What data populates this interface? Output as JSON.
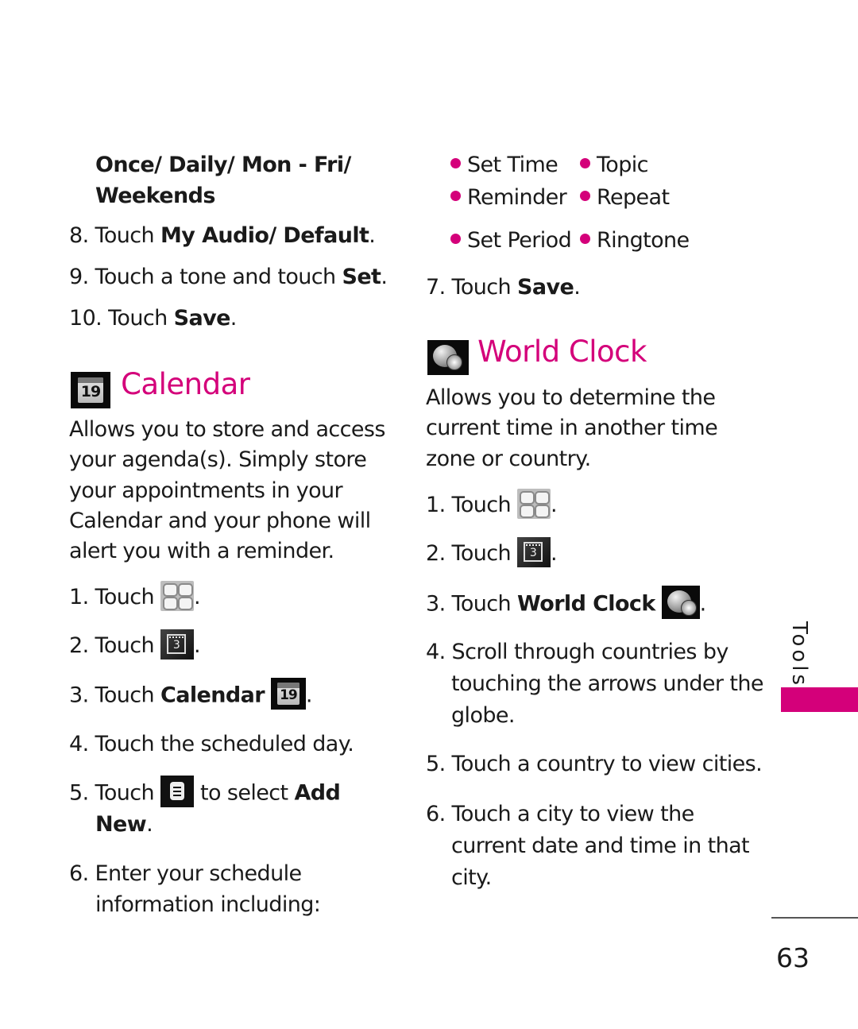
{
  "left_column": {
    "continued_options": {
      "text": "Once/ Daily/ Mon - Fri/",
      "text2": "Weekends"
    },
    "steps_top": [
      {
        "num": "8.",
        "pre": "Touch ",
        "bold": "My Audio/ Default",
        "post": "."
      },
      {
        "num": "9.",
        "pre": "Touch a tone and touch ",
        "bold": "Set",
        "post": "."
      },
      {
        "num": "10.",
        "pre": "Touch ",
        "bold": "Save",
        "post": "."
      }
    ],
    "calendar_section": {
      "icon": "calendar-icon",
      "icon_day": "19",
      "heading": "Calendar",
      "description": [
        "Allows you to store and access",
        "your agenda(s). Simply store",
        "your appointments in your",
        "Calendar and your phone will",
        "alert you with a reminder."
      ],
      "steps": [
        {
          "num": "1.",
          "pre": "Touch",
          "icon": "menu-grid-icon",
          "post": "."
        },
        {
          "num": "2.",
          "pre": "Touch",
          "icon": "tools-icon",
          "icon_text": "3",
          "post": "."
        },
        {
          "num": "3.",
          "pre": "Touch ",
          "bold": "Calendar",
          "icon": "calendar-icon",
          "icon_day": "19",
          "post": "."
        },
        {
          "num": "4.",
          "text": "Touch the scheduled day."
        },
        {
          "num": "5.",
          "pre": "Touch",
          "icon": "options-icon",
          "mid": " to select ",
          "bold": "Add",
          "line2_bold": "New",
          "post": "."
        },
        {
          "num": "6.",
          "text": "Enter your schedule",
          "text2": "information including:"
        }
      ]
    }
  },
  "right_column": {
    "schedule_fields": [
      [
        "Set Time",
        "Topic"
      ],
      [
        "Reminder",
        "Repeat"
      ],
      [
        "Set Period",
        "Ringtone"
      ]
    ],
    "step7": {
      "num": "7.",
      "pre": "Touch ",
      "bold": "Save",
      "post": "."
    },
    "world_clock_section": {
      "icon": "world-clock-icon",
      "heading": "World Clock",
      "description": [
        "Allows you to determine the",
        "current time in another time",
        "zone or country."
      ],
      "steps": [
        {
          "num": "1.",
          "pre": "Touch",
          "icon": "menu-grid-icon",
          "post": "."
        },
        {
          "num": "2.",
          "pre": "Touch",
          "icon": "tools-icon",
          "icon_text": "3",
          "post": "."
        },
        {
          "num": "3.",
          "pre": "Touch ",
          "bold": "World Clock",
          "icon": "world-clock-icon",
          "post": "."
        },
        {
          "num": "4.",
          "lines": [
            "Scroll through countries by",
            "touching the arrows under the",
            "globe."
          ]
        },
        {
          "num": "5.",
          "lines": [
            "Touch a country to view cities."
          ]
        },
        {
          "num": "6.",
          "lines": [
            "Touch a city to view the",
            "current date and time in that",
            "city."
          ]
        }
      ]
    }
  },
  "sidebar": {
    "section_label": "Tools"
  },
  "footer": {
    "page_number": "63"
  },
  "colors": {
    "accent": "#d4007a",
    "text": "#1a1a1a"
  }
}
